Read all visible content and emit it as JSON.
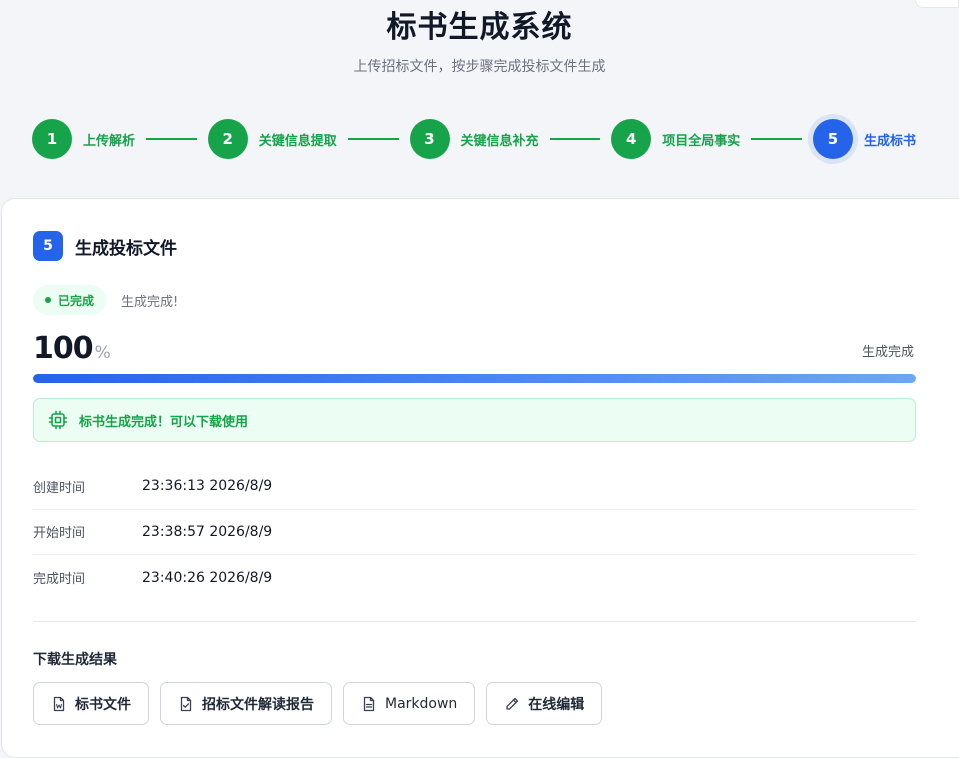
{
  "header": {
    "title": "标书生成系统",
    "subtitle": "上传招标文件，按步骤完成投标文件生成"
  },
  "steps": [
    {
      "num": "1",
      "label": "上传解析",
      "state": "done"
    },
    {
      "num": "2",
      "label": "关键信息提取",
      "state": "done"
    },
    {
      "num": "3",
      "label": "关键信息补充",
      "state": "done"
    },
    {
      "num": "4",
      "label": "项目全局事实",
      "state": "done"
    },
    {
      "num": "5",
      "label": "生成标书",
      "state": "active"
    }
  ],
  "card": {
    "badge": "5",
    "title": "生成投标文件",
    "status_pill": "已完成",
    "status_msg": "生成完成!",
    "percent": "100",
    "percent_sign": "%",
    "percent_note": "生成完成",
    "progress_fraction": 1.0,
    "alert": "标书生成完成！可以下载使用",
    "info": [
      {
        "label": "创建时间",
        "value": "23:36:13 2026/8/9"
      },
      {
        "label": "开始时间",
        "value": "23:38:57 2026/8/9"
      },
      {
        "label": "完成时间",
        "value": "23:40:26 2026/8/9"
      }
    ],
    "download_title": "下载生成结果",
    "buttons": [
      {
        "label": "标书文件",
        "icon": "word-file-icon"
      },
      {
        "label": "招标文件解读报告",
        "icon": "file-check-icon"
      },
      {
        "label": "Markdown",
        "icon": "document-icon"
      },
      {
        "label": "在线编辑",
        "icon": "pencil-icon"
      }
    ]
  },
  "colors": {
    "success": "#16a34a",
    "primary": "#2563eb",
    "success_bg": "#ecfdf3"
  }
}
